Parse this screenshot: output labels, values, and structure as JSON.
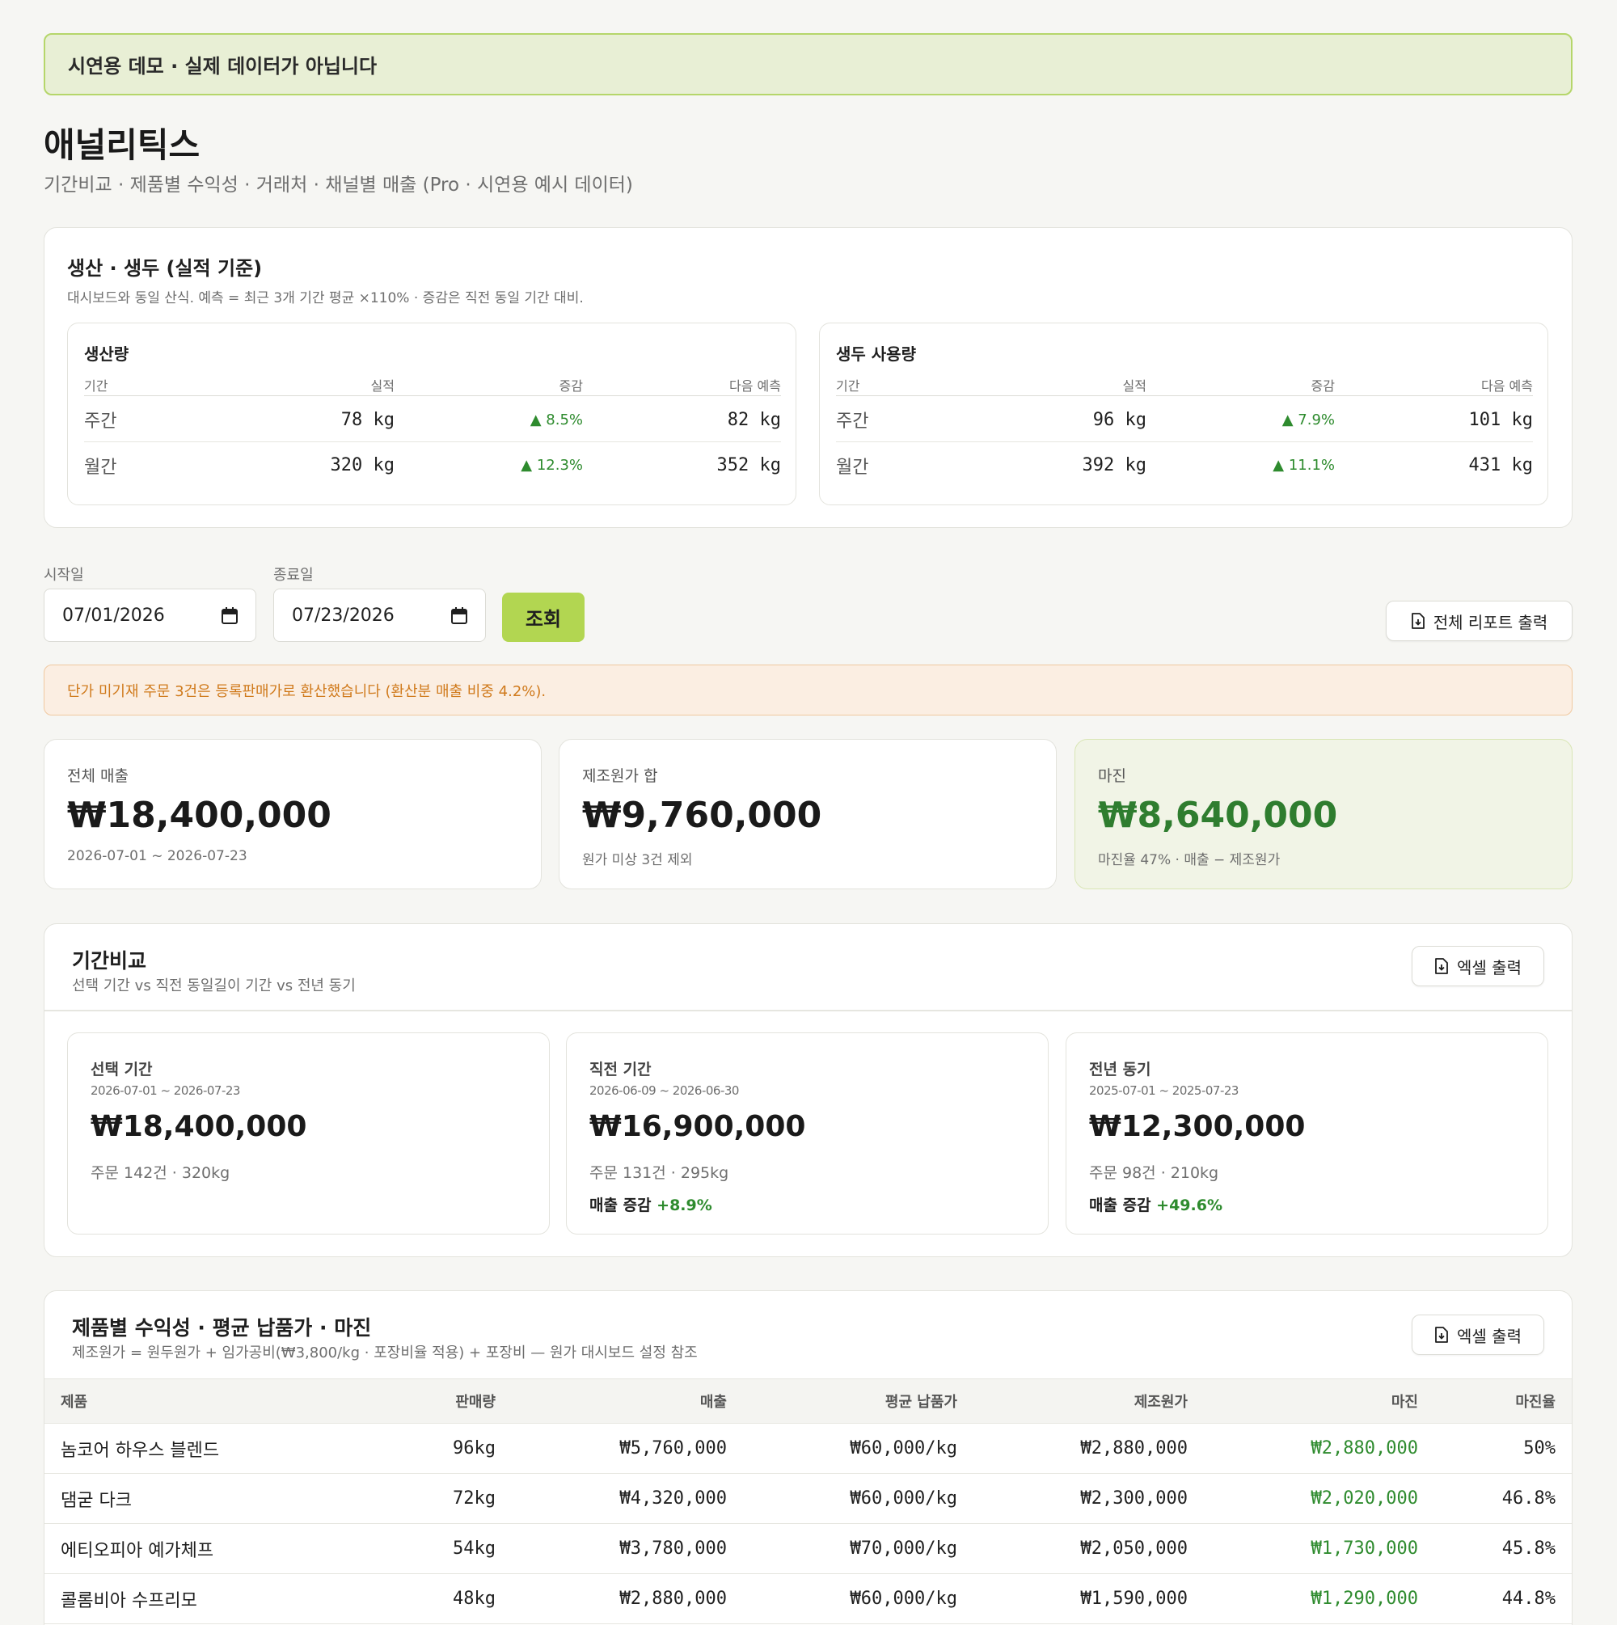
{
  "demo_banner": "시연용 데모 · 실제 데이터가 아닙니다",
  "page": {
    "title": "애널리틱스",
    "subtitle": "기간비교 · 제품별 수익성 · 거래처 · 채널별 매출 (Pro · 시연용 예시 데이터)"
  },
  "production": {
    "title": "생산 · 생두 (실적 기준)",
    "description": "대시보드와 동일 산식. 예측 = 최근 3개 기간 평균 ×110% · 증감은 직전 동일 기간 대비.",
    "columns": [
      "기간",
      "실적",
      "증감",
      "다음 예측"
    ],
    "output": {
      "title": "생산량",
      "rows": [
        {
          "period": "주간",
          "actual": "78 kg",
          "delta": "▲ 8.5%",
          "next": "82 kg"
        },
        {
          "period": "월간",
          "actual": "320 kg",
          "delta": "▲ 12.3%",
          "next": "352 kg"
        }
      ]
    },
    "green_bean": {
      "title": "생두 사용량",
      "rows": [
        {
          "period": "주간",
          "actual": "96 kg",
          "delta": "▲ 7.9%",
          "next": "101 kg"
        },
        {
          "period": "월간",
          "actual": "392 kg",
          "delta": "▲ 11.1%",
          "next": "431 kg"
        }
      ]
    }
  },
  "filters": {
    "start_label": "시작일",
    "start_value": "07/01/2026",
    "end_label": "종료일",
    "end_value": "07/23/2026",
    "query_button": "조회",
    "report_button": "전체 리포트 출력"
  },
  "warning": "단가 미기재 주문 3건은 등록판매가로 환산했습니다 (환산분 매출 비중 4.2%).",
  "summary": {
    "revenue": {
      "label": "전체 매출",
      "value": "₩18,400,000",
      "note": "2026-07-01 ~ 2026-07-23"
    },
    "cost": {
      "label": "제조원가 합",
      "value": "₩9,760,000",
      "note": "원가 미상 3건 제외"
    },
    "margin": {
      "label": "마진",
      "value": "₩8,640,000",
      "note": "마진율 47% · 매출 − 제조원가"
    }
  },
  "compare": {
    "title": "기간비교",
    "description": "선택 기간 vs 직전 동일길이 기간 vs 전년 동기",
    "excel_button": "엑셀 출력",
    "delta_label": "매출 증감",
    "periods": [
      {
        "label": "선택 기간",
        "range": "2026-07-01 ~ 2026-07-23",
        "value": "₩18,400,000",
        "meta": "주문 142건 · 320kg",
        "delta": ""
      },
      {
        "label": "직전 기간",
        "range": "2026-06-09 ~ 2026-06-30",
        "value": "₩16,900,000",
        "meta": "주문 131건 · 295kg",
        "delta": "+8.9%"
      },
      {
        "label": "전년 동기",
        "range": "2025-07-01 ~ 2025-07-23",
        "value": "₩12,300,000",
        "meta": "주문 98건 · 210kg",
        "delta": "+49.6%"
      }
    ]
  },
  "products": {
    "title": "제품별 수익성 · 평균 납품가 · 마진",
    "description": "제조원가 = 원두원가 + 임가공비(₩3,800/kg · 포장비율 적용) + 포장비 — 원가 대시보드 설정 참조",
    "excel_button": "엑셀 출력",
    "columns": [
      "제품",
      "판매량",
      "매출",
      "평균 납품가",
      "제조원가",
      "마진",
      "마진율"
    ],
    "rows": [
      [
        "놈코어 하우스 블렌드",
        "96kg",
        "₩5,760,000",
        "₩60,000/kg",
        "₩2,880,000",
        "₩2,880,000",
        "50%"
      ],
      [
        "댐굳 다크",
        "72kg",
        "₩4,320,000",
        "₩60,000/kg",
        "₩2,300,000",
        "₩2,020,000",
        "46.8%"
      ],
      [
        "에티오피아 예가체프",
        "54kg",
        "₩3,780,000",
        "₩70,000/kg",
        "₩2,050,000",
        "₩1,730,000",
        "45.8%"
      ],
      [
        "콜롬비아 수프리모",
        "48kg",
        "₩2,880,000",
        "₩60,000/kg",
        "₩1,590,000",
        "₩1,290,000",
        "44.8%"
      ]
    ]
  },
  "colors": {
    "accent": "#b2d651",
    "positive": "#2e8b2e",
    "warning": "#d07a1c"
  }
}
